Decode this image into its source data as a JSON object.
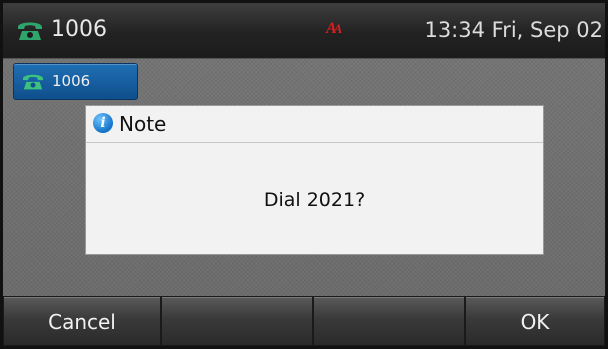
{
  "title_bar": {
    "account": "1006",
    "status_icon_letters": [
      "A",
      "A"
    ],
    "datetime": "13:34 Fri, Sep 02",
    "phone_icon": "phone-handset-icon"
  },
  "line_key": {
    "label": "1006",
    "icon": "phone-handset-icon"
  },
  "dialog": {
    "icon": "info-icon",
    "icon_glyph": "i",
    "title": "Note",
    "message": "Dial 2021?"
  },
  "softkeys": [
    "Cancel",
    "",
    "",
    "OK"
  ],
  "colors": {
    "line_key": "#1a5f9f",
    "status_icon": "#d81e1e",
    "phone_icon": "#2ea66b"
  }
}
